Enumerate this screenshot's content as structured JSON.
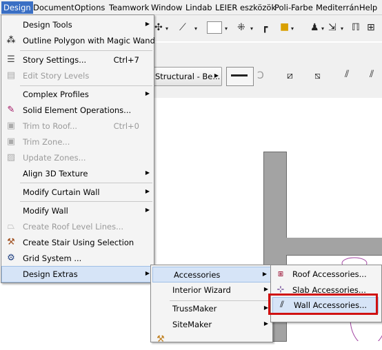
{
  "menubar": {
    "items": [
      "Design",
      "Document",
      "Options",
      "Teamwork",
      "Window",
      "Lindab",
      "LEIER eszközök",
      "Poli-Farbe",
      "Mediterrán",
      "Help"
    ]
  },
  "toolbar": {
    "structural_combo": "Structural - Be..."
  },
  "design_menu": {
    "items": [
      {
        "label": "Design Tools",
        "shortcut": "",
        "submenu": true,
        "disabled": false,
        "icon": "none"
      },
      {
        "label": "Outline Polygon with Magic Wand",
        "shortcut": "",
        "submenu": false,
        "disabled": false,
        "icon": "magic-wand-icon"
      },
      {
        "label": "Story Settings...",
        "shortcut": "Ctrl+7",
        "submenu": false,
        "disabled": false,
        "icon": "story-settings-icon"
      },
      {
        "label": "Edit Story Levels",
        "shortcut": "",
        "submenu": false,
        "disabled": true,
        "icon": "story-levels-icon"
      },
      {
        "label": "Complex Profiles",
        "shortcut": "",
        "submenu": true,
        "disabled": false,
        "icon": "none"
      },
      {
        "label": "Solid Element Operations...",
        "shortcut": "",
        "submenu": false,
        "disabled": false,
        "icon": "solid-ops-icon"
      },
      {
        "label": "Trim to Roof...",
        "shortcut": "Ctrl+0",
        "submenu": false,
        "disabled": true,
        "icon": "trim-roof-icon"
      },
      {
        "label": "Trim Zone...",
        "shortcut": "",
        "submenu": false,
        "disabled": true,
        "icon": "trim-zone-icon"
      },
      {
        "label": "Update Zones...",
        "shortcut": "",
        "submenu": false,
        "disabled": true,
        "icon": "update-zones-icon"
      },
      {
        "label": "Align 3D Texture",
        "shortcut": "",
        "submenu": true,
        "disabled": false,
        "icon": "none"
      },
      {
        "label": "Modify Curtain Wall",
        "shortcut": "",
        "submenu": true,
        "disabled": false,
        "icon": "none"
      },
      {
        "label": "Modify Wall",
        "shortcut": "",
        "submenu": true,
        "disabled": false,
        "icon": "none"
      },
      {
        "label": "Create Roof Level Lines...",
        "shortcut": "",
        "submenu": false,
        "disabled": true,
        "icon": "roof-level-icon"
      },
      {
        "label": "Create Stair Using Selection",
        "shortcut": "",
        "submenu": false,
        "disabled": false,
        "icon": "stair-icon"
      },
      {
        "label": "Grid System ...",
        "shortcut": "",
        "submenu": false,
        "disabled": false,
        "icon": "grid-system-icon"
      },
      {
        "label": "Design Extras",
        "shortcut": "",
        "submenu": true,
        "disabled": false,
        "icon": "none"
      }
    ]
  },
  "extras_menu": {
    "items": [
      {
        "label": "Accessories",
        "submenu": true
      },
      {
        "label": "Interior Wizard",
        "submenu": true
      },
      {
        "label": "TrussMaker",
        "submenu": true
      },
      {
        "label": "SiteMaker",
        "submenu": true
      }
    ]
  },
  "accessories_menu": {
    "items": [
      {
        "label": "Roof Accessories...",
        "icon": "roof-accessories-icon"
      },
      {
        "label": "Slab Accessories...",
        "icon": "slab-accessories-icon"
      },
      {
        "label": "Wall Accessories...",
        "icon": "wall-accessories-icon"
      }
    ]
  },
  "colors": {
    "highlight": "#d6e4f7",
    "menubar_active": "#3a6fc4",
    "callout_border": "#d01010",
    "wall_fill": "#a3a3a3"
  }
}
